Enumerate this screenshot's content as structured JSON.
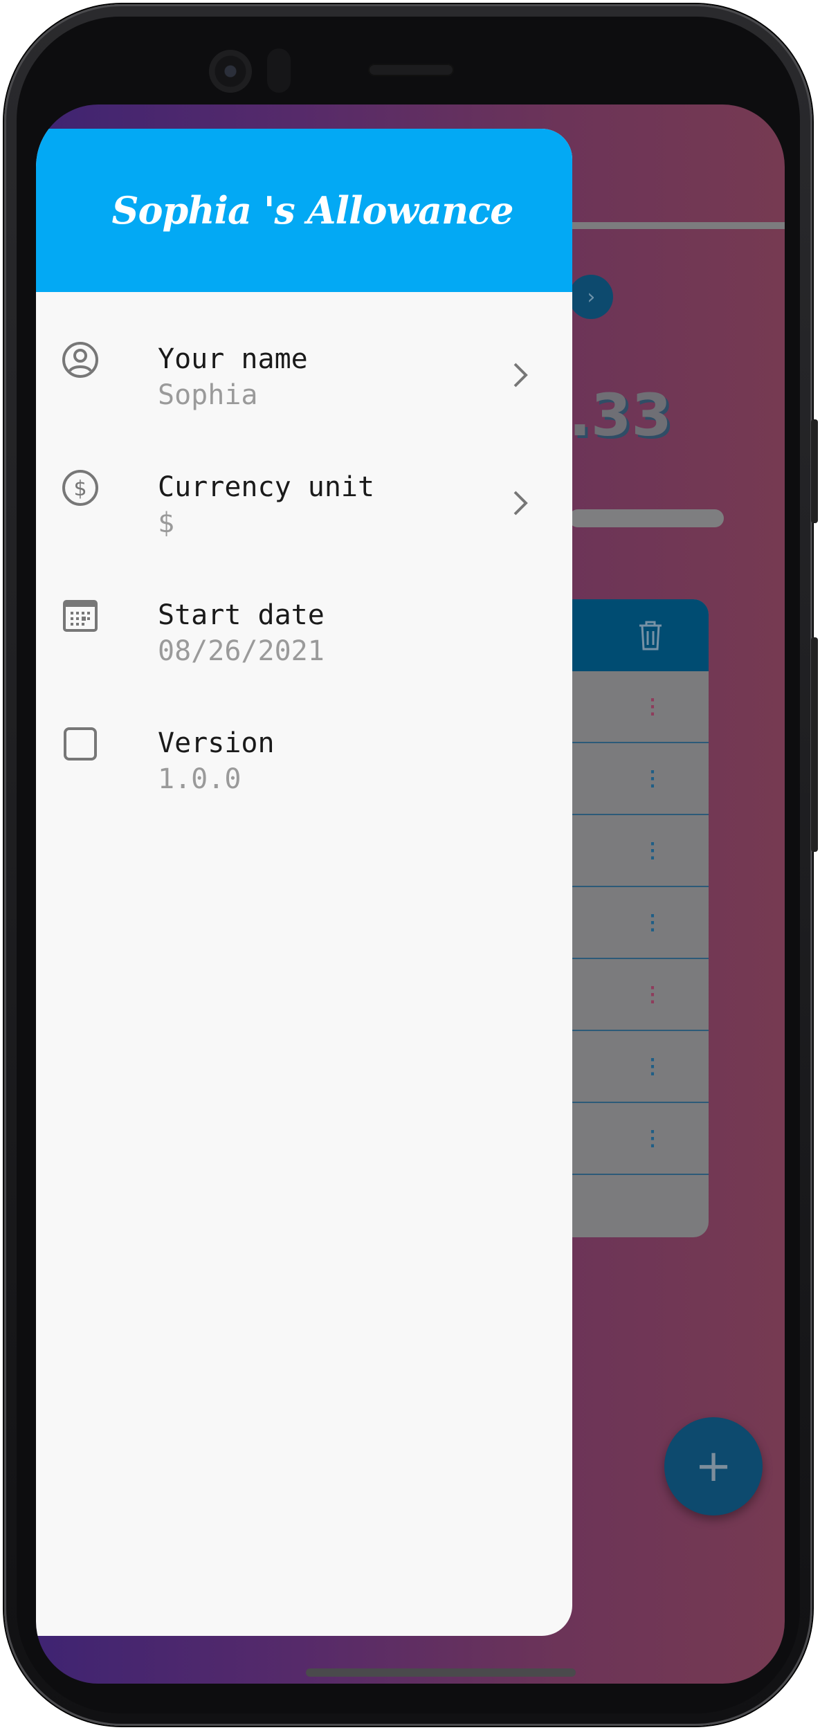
{
  "drawer": {
    "title": "Sophia 's Allowance",
    "items": [
      {
        "label": "Your name",
        "value": "Sophia",
        "icon": "account-circle-icon",
        "has_chevron": true
      },
      {
        "label": "Currency unit",
        "value": "$",
        "icon": "dollar-circle-icon",
        "has_chevron": true
      },
      {
        "label": "Start date",
        "value": "08/26/2021",
        "icon": "calendar-icon",
        "has_chevron": false
      },
      {
        "label": "Version",
        "value": "1.0.0",
        "icon": "square-outline-icon",
        "has_chevron": false
      }
    ]
  },
  "background": {
    "amount_fragment": ".33",
    "fab_label": "+",
    "row_count": 7
  },
  "colors": {
    "drawer_header": "#03a9f4",
    "drawer_body": "#f8f8f8",
    "accent_dark": "#004c72",
    "gradient_left": "#3f2472",
    "gradient_right": "#763a52"
  }
}
